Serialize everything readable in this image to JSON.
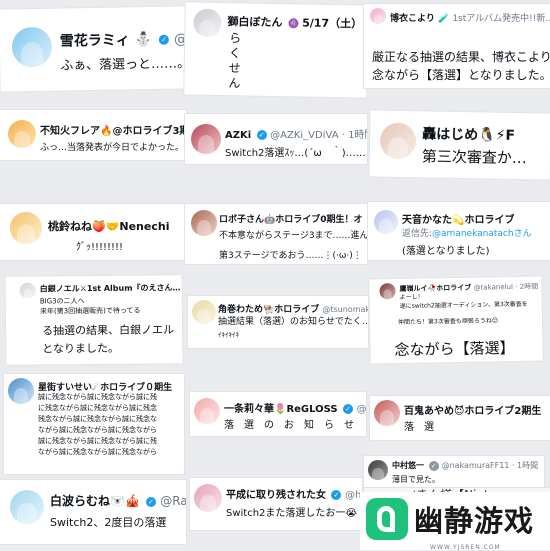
{
  "cards": [
    {
      "name": "雪花ラミィ",
      "handle": "@yu",
      "badge": "✓",
      "emoji": "⛄",
      "body": "ふぁ、落選っと……。"
    },
    {
      "name": "獅白ぼたん",
      "handle": "5/17（土）",
      "badge": "♌",
      "body_lines": [
        "ら",
        "く",
        "せ",
        "ん"
      ]
    },
    {
      "name": "博衣こより",
      "handle": "1stアルバム発売中!!新…",
      "badge": "🧪",
      "body_lines": [
        "厳正なる抽選の結果、博衣こより",
        "念ながら【落選】となりました。"
      ]
    },
    {
      "name": "不知火フレア🔥@ホロライブ3期",
      "handle": "",
      "body": "ふっ…当落発表が今日でよかった。"
    },
    {
      "name": "AZKi",
      "handle": "@AZKi_VDiVA · 1時間",
      "body": "Switch2落選ｽｯ…(´ω　｀)……"
    },
    {
      "name": "轟はじめ🐧⚡F",
      "handle": "",
      "body": "第三次審査か…"
    },
    {
      "name": "桃鈴ねね🍑🤝Nenechi",
      "handle": "",
      "body": "ｸﾞｯ!!!!!!!!"
    },
    {
      "name": "ロボ子さん🤖ホロライブ0期生！オ",
      "handle": "",
      "body_lines": [
        "不本意ながらステージ3まで……進ん",
        "第3ステージであおう……⋮(·ω·)⋮"
      ]
    },
    {
      "name": "天音かなた💫ホロライブ",
      "handle": "返信先:",
      "reply_to": "@amanekanatachさん",
      "body": "(落選となりました)"
    },
    {
      "name": "白銀ノエル⚔1st Album『のえさん…",
      "handle": "",
      "body_lines": [
        "BIG3の二人へ",
        "来年(第3回抽選販売)で待ってる",
        "る抽選の結果、白銀ノエル",
        "となりました。"
      ]
    },
    {
      "name": "角巻わため🐏ホロライブ",
      "handle": "@tsunomakiwatame",
      "body_lines": [
        "抽選結果（落選）のお知らせでたく…",
        "ｲｷｲｷｲｷ"
      ]
    },
    {
      "name": "鷹嶺ルイ🥀ホロライブ",
      "handle": "@takaneluI · 2時間",
      "body_lines": [
        "よーし！",
        "遂にswitch2抽選オーディション、第3次審査を",
        "仲間たち！第3次審査も頑張ろうね😊",
        "念ながら【落選】"
      ]
    },
    {
      "name": "星街すいせい☄ホロライブ０期生",
      "handle": "",
      "body_lines": [
        "誠に残念ながら誠に残念ながら誠に残",
        "に残念ながら誠に残念ながら誠に残念",
        "残念ながら誠に残念ながら誠に残念な",
        "ながら誠に残念ながら誠に残念ながら",
        "誠に残念ながら誠に残念ながら誠に残",
        "ながら誠に残念ながら誠に残念ながら"
      ]
    },
    {
      "name": "一条莉々華🌷ReGLOSS",
      "handle": "@ic",
      "body": "落　選　の　お　知　ら　せ"
    },
    {
      "name": "百鬼あやめ😈ホロライブ2期生",
      "handle": "",
      "body": "落　選"
    },
    {
      "name": "中村悠一",
      "handle": "@nakamuraFF11 · 1時間",
      "body": "薄目で見た。"
    },
    {
      "name": "白波らむね🐻‍❄🎪",
      "handle": "@Ra",
      "body": "Switch2、2度目の落選"
    },
    {
      "name": "平成に取り残された女",
      "handle": "@hinar",
      "body": "Switch2また落選したお一😭"
    }
  ],
  "bottom_strip": "ﾉきん様【Ninte",
  "brand": {
    "text": "幽静游戏",
    "url": "WWW.YJSREN.COM",
    "accent": "#1fc27a"
  },
  "colors": {
    "verified": "#1d9bf0",
    "bg": "#e9ebee"
  }
}
